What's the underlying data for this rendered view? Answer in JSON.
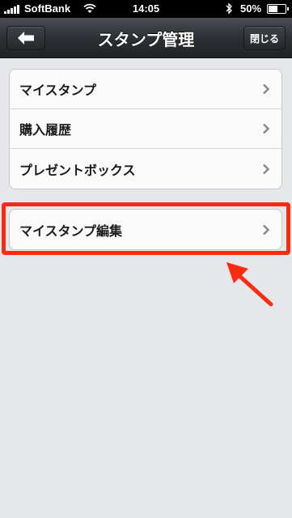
{
  "status_bar": {
    "carrier": "SoftBank",
    "time": "14:05",
    "battery": "50%",
    "battery_level": 0.5
  },
  "nav_bar": {
    "title": "スタンプ管理",
    "close_label": "閉じる"
  },
  "menu": {
    "items": [
      {
        "label": "マイスタンプ"
      },
      {
        "label": "購入履歴"
      },
      {
        "label": "プレゼントボックス"
      }
    ]
  },
  "edit_menu": {
    "label": "マイスタンプ編集"
  },
  "colors": {
    "annotation": "#ff2a10",
    "nav_background": "#2d3034"
  }
}
